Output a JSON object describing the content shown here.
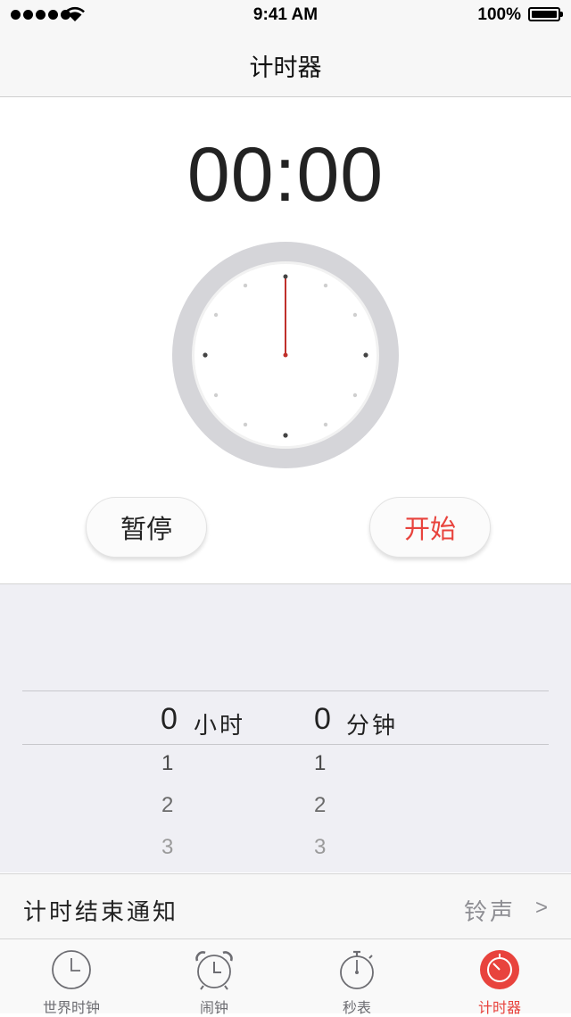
{
  "status_bar": {
    "time": "9:41 AM",
    "battery": "100%"
  },
  "nav": {
    "title": "计时器"
  },
  "timer": {
    "display": "00:00",
    "pause_label": "暂停",
    "start_label": "开始"
  },
  "picker": {
    "hours": {
      "selected": "0",
      "unit": "小时",
      "below": [
        "1",
        "2",
        "3"
      ]
    },
    "minutes": {
      "selected": "0",
      "unit": "分钟",
      "below": [
        "1",
        "2",
        "3"
      ]
    }
  },
  "notification": {
    "label": "计时结束通知",
    "value": "铃声",
    "chevron": ">"
  },
  "tabs": [
    {
      "label": "世界时钟",
      "icon": "world-clock-icon",
      "active": false
    },
    {
      "label": "闹钟",
      "icon": "alarm-icon",
      "active": false
    },
    {
      "label": "秒表",
      "icon": "stopwatch-icon",
      "active": false
    },
    {
      "label": "计时器",
      "icon": "timer-icon",
      "active": true
    }
  ],
  "colors": {
    "accent": "#e8433d",
    "background": "#efeff4"
  }
}
